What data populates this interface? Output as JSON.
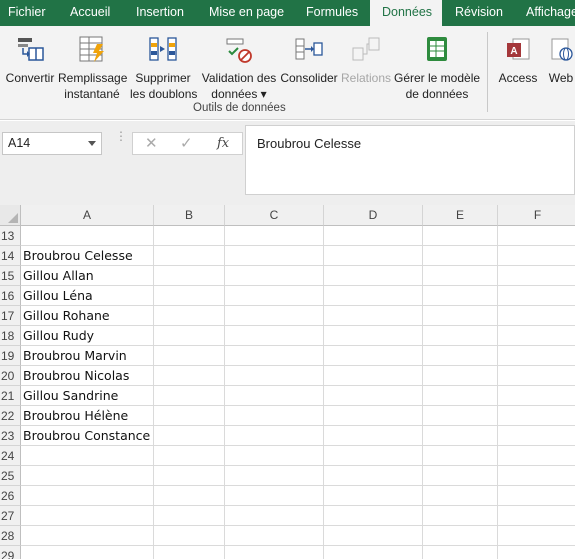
{
  "ribbon_tabs": [
    {
      "label": "Fichier",
      "active": false
    },
    {
      "label": "Accueil",
      "active": false
    },
    {
      "label": "Insertion",
      "active": false
    },
    {
      "label": "Mise en page",
      "active": false
    },
    {
      "label": "Formules",
      "active": false
    },
    {
      "label": "Données",
      "active": true
    },
    {
      "label": "Révision",
      "active": false
    },
    {
      "label": "Affichage",
      "active": false
    }
  ],
  "ribbon": {
    "convertir": "Convertir",
    "remplissage_l1": "Remplissage",
    "remplissage_l2": "instantané",
    "supprimer_l1": "Supprimer",
    "supprimer_l2": "les doublons",
    "validation_l1": "Validation des",
    "validation_l2": "données ▾",
    "consolider": "Consolider",
    "relations": "Relations",
    "gerer_l1": "Gérer le modèle",
    "gerer_l2": "de données",
    "access": "Access",
    "web": "Web",
    "group_label": "Outils de données"
  },
  "formula_bar": {
    "name_box": "A14",
    "cancel": "✕",
    "enter": "✓",
    "fx": "fx",
    "content": "Broubrou Celesse"
  },
  "columns": [
    "A",
    "B",
    "C",
    "D",
    "E",
    "F"
  ],
  "rows": [
    {
      "num": "13",
      "a": ""
    },
    {
      "num": "14",
      "a": "Broubrou Celesse"
    },
    {
      "num": "15",
      "a": "Gillou Allan"
    },
    {
      "num": "16",
      "a": "Gillou Léna"
    },
    {
      "num": "17",
      "a": "Gillou Rohane"
    },
    {
      "num": "18",
      "a": "Gillou Rudy"
    },
    {
      "num": "19",
      "a": "Broubrou Marvin"
    },
    {
      "num": "20",
      "a": "Broubrou Nicolas"
    },
    {
      "num": "21",
      "a": "Gillou Sandrine"
    },
    {
      "num": "22",
      "a": "Broubrou Hélène"
    },
    {
      "num": "23",
      "a": "Broubrou Constance"
    },
    {
      "num": "24",
      "a": ""
    },
    {
      "num": "25",
      "a": ""
    },
    {
      "num": "26",
      "a": ""
    },
    {
      "num": "27",
      "a": ""
    },
    {
      "num": "28",
      "a": ""
    },
    {
      "num": "29",
      "a": ""
    }
  ],
  "colors": {
    "accent": "#217346",
    "ribbon_bg": "#f3f3f3"
  }
}
